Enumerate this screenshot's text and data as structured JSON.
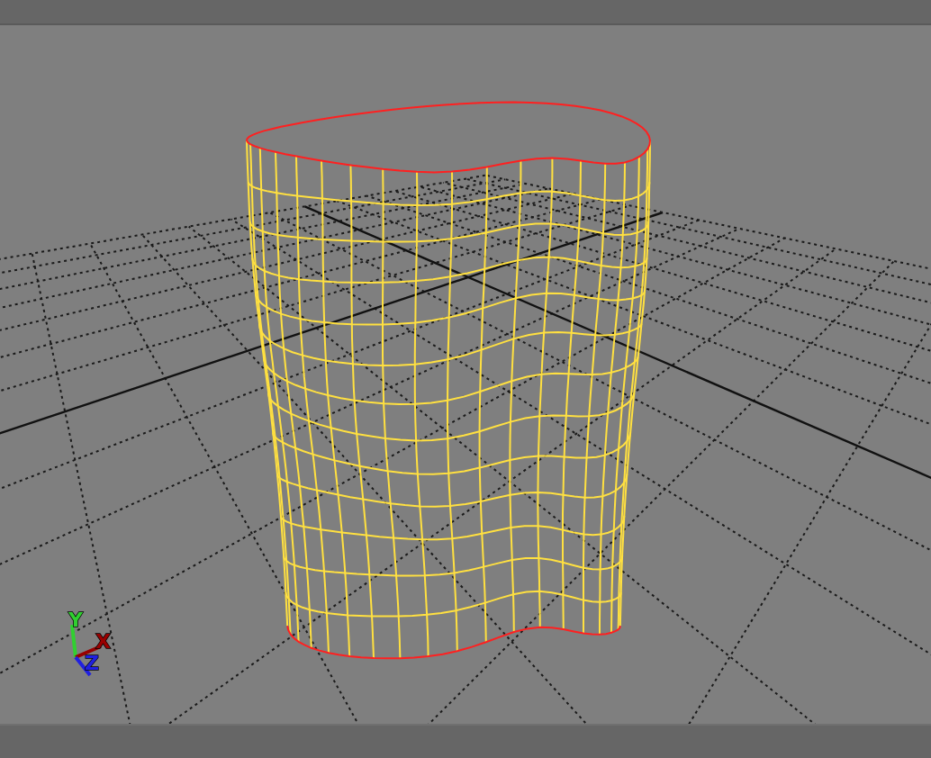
{
  "viewport": {
    "axes": [
      {
        "label": "Y",
        "color": "#30d030"
      },
      {
        "label": "X",
        "color": "#990000"
      },
      {
        "label": "Z",
        "color": "#2020e0"
      }
    ]
  }
}
